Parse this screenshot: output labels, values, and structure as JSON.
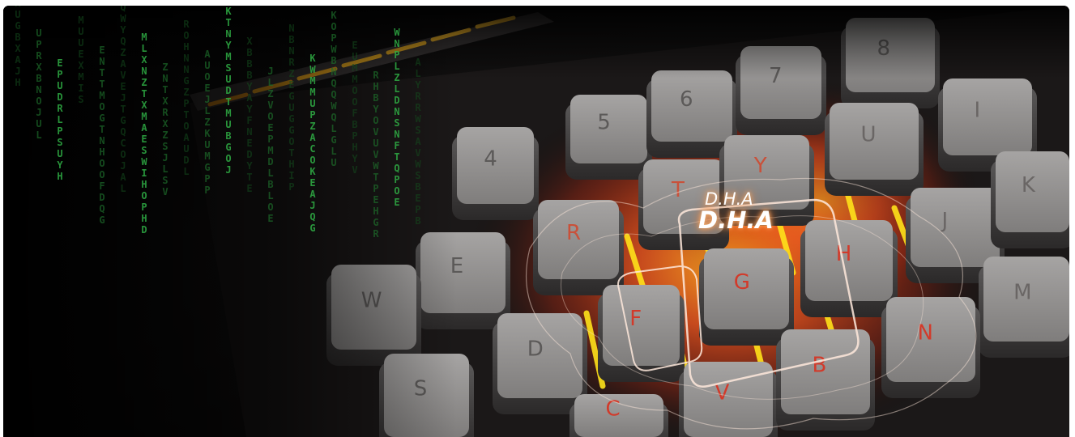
{
  "logo": {
    "line1": "D.H.A",
    "line2": "D.H.A"
  },
  "keycap_legends": [
    "5",
    "6",
    "7",
    "8",
    "4",
    "T",
    "Y",
    "U",
    "I",
    "R",
    "J",
    "K",
    "E",
    "G",
    "H",
    "M",
    "W",
    "F",
    "N",
    "D",
    "V",
    "B",
    "S",
    "C"
  ],
  "matrix_columns": [
    "XUGBXAJH",
    "UPRXBNOJUL",
    "EPUDRLPSUYH",
    "MUUEXMIS",
    "ENTTMOGTNHOOFDQG",
    "QWYQZAVEJTGQCOJAL",
    "MLXNZTXMAESWIHOPHD",
    "ZNTXRXZSJLSV",
    "ROHNNGZPTOAUDL",
    "AUOEJLZKUMGPP",
    "KTNYMSUDTMUBGOJ",
    "XBBBYAYFNEDYTE",
    "JLZVOEPMDLBLOE",
    "NBNRZEGUGGOTHIP",
    "KWMMUPZACOKEAJQG",
    "KOPWBNQQWQLGLU",
    "EUMMOOFBPHYV",
    "RHBYOVUVWTPEHGR",
    "WNPLZLDNSNFTQPOE",
    "ALYRRWSAVWSBEPB"
  ],
  "colors": {
    "glow_orange": "#ff5a1f",
    "glow_yellow": "#ffe21a",
    "matrix_green": "#2fae45",
    "keycap": "#8f8d8c"
  }
}
